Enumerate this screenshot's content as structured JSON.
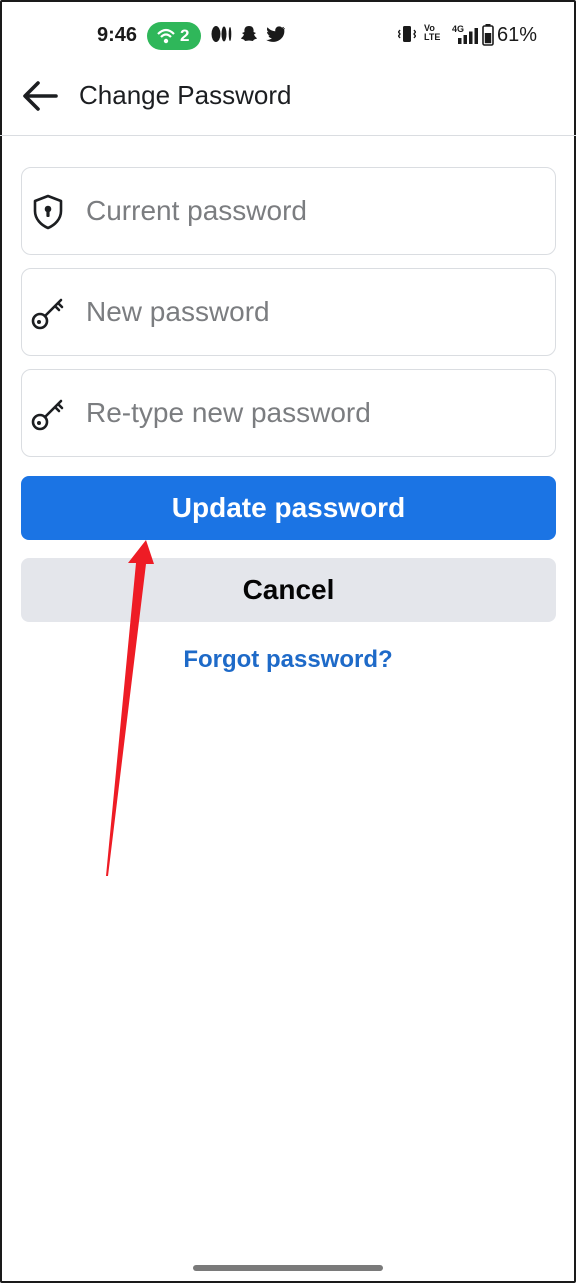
{
  "status_bar": {
    "time": "9:46",
    "hotspot_count": "2",
    "battery_percent": "61%",
    "volte_label": "Vo LTE",
    "network_label": "4G"
  },
  "header": {
    "title": "Change Password"
  },
  "form": {
    "current_password_placeholder": "Current password",
    "new_password_placeholder": "New password",
    "retype_password_placeholder": "Re-type new password"
  },
  "actions": {
    "update_label": "Update password",
    "cancel_label": "Cancel",
    "forgot_label": "Forgot password?"
  },
  "icons": {
    "back": "arrow-left-icon",
    "current_password": "shield-lock-icon",
    "new_password": "key-icon",
    "retype_password": "key-icon"
  },
  "colors": {
    "primary": "#1b74e4",
    "link": "#1e6ac8",
    "annotation": "#ee1c25",
    "hotspot": "#2fb75a"
  }
}
